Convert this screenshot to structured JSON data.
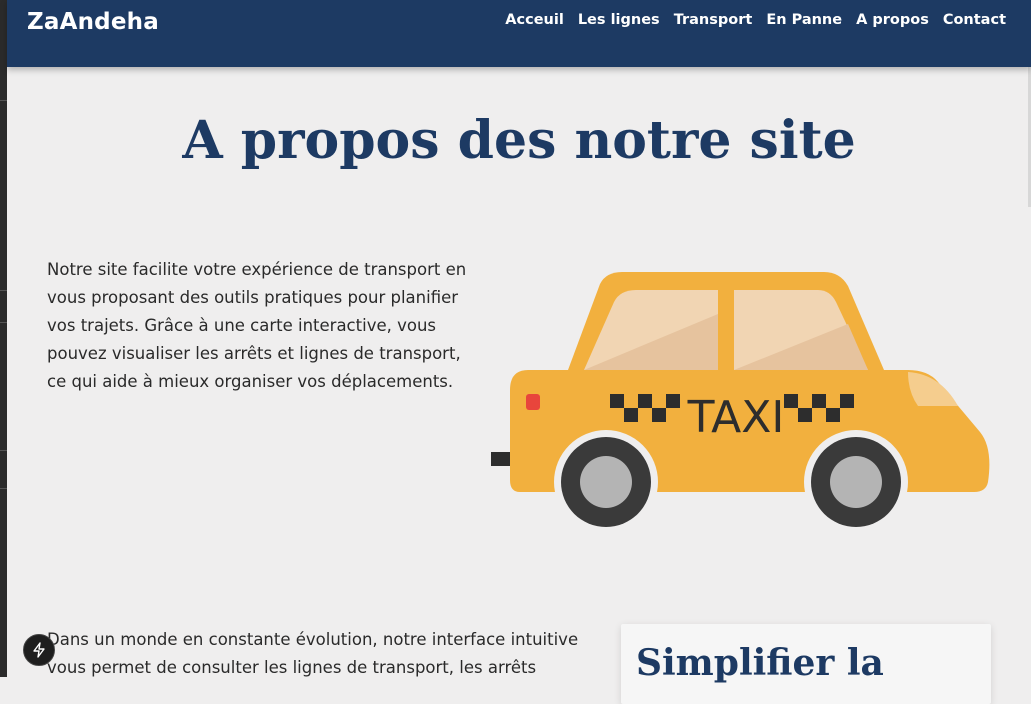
{
  "site": {
    "brand": "ZaAndeha"
  },
  "nav": {
    "items": [
      {
        "label": "Acceuil"
      },
      {
        "label": "Les lignes"
      },
      {
        "label": "Transport"
      },
      {
        "label": "En Panne"
      },
      {
        "label": "A propos"
      },
      {
        "label": "Contact"
      }
    ]
  },
  "main": {
    "title": "A propos des notre site",
    "intro": "Notre site facilite votre expérience de transport en vous proposant des outils pratiques pour planifier vos trajets. Grâce à une carte interactive, vous pouvez visualiser les arrêts et lignes de transport, ce qui aide à mieux organiser vos déplacements.",
    "taxi_sign": "TAXI",
    "paragraph2": "Dans un monde en constante évolution, notre interface intuitive vous permet de consulter les lignes de transport, les arrêts",
    "card_title": "Simplifier la"
  },
  "icons": {
    "fab": "lightning-icon",
    "illustration": "taxi-illustration"
  },
  "colors": {
    "navbar": "#1d3a63",
    "title": "#1d3a63",
    "background": "#efeeee",
    "taxi_body": "#f2b03e"
  }
}
